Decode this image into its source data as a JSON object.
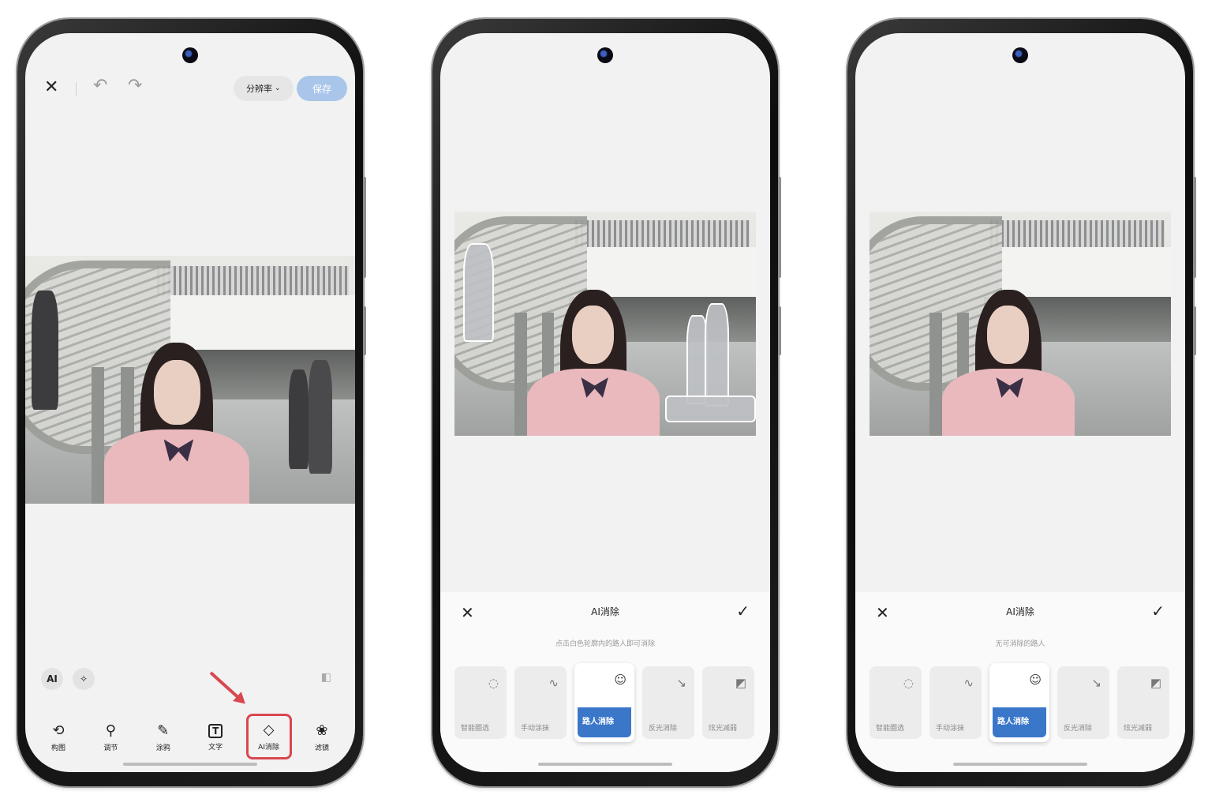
{
  "phone1": {
    "resolution_label": "分辨率",
    "save_label": "保存",
    "chips": [
      "AI"
    ],
    "tools": [
      {
        "label": "构图",
        "icon": "crop-rotate-icon"
      },
      {
        "label": "调节",
        "icon": "sliders-icon"
      },
      {
        "label": "涂鸦",
        "icon": "pen-icon"
      },
      {
        "label": "文字",
        "icon": "text-box-icon"
      },
      {
        "label": "AI消除",
        "icon": "eraser-icon"
      },
      {
        "label": "滤镜",
        "icon": "filter-circles-icon"
      }
    ]
  },
  "phone2": {
    "panel_title": "AI消除",
    "hint": "点击白色轮廓内的路人即可消除",
    "modes": [
      {
        "label": "智能圈选",
        "icon": "ai-lasso-icon"
      },
      {
        "label": "手动涂抹",
        "icon": "brush-stroke-icon"
      },
      {
        "label": "路人消除",
        "icon": "passerby-icon"
      },
      {
        "label": "反光消除",
        "icon": "reflection-icon"
      },
      {
        "label": "炫光减弱",
        "icon": "glare-icon"
      }
    ],
    "active_mode": "路人消除"
  },
  "phone3": {
    "panel_title": "AI消除",
    "hint": "无可消除的路人",
    "modes": [
      {
        "label": "智能圈选",
        "icon": "ai-lasso-icon"
      },
      {
        "label": "手动涂抹",
        "icon": "brush-stroke-icon"
      },
      {
        "label": "路人消除",
        "icon": "passerby-icon"
      },
      {
        "label": "反光消除",
        "icon": "reflection-icon"
      },
      {
        "label": "炫光减弱",
        "icon": "glare-icon"
      }
    ],
    "active_mode": "路人消除"
  },
  "colors": {
    "accent": "#3a77c9",
    "highlight": "#d9474f",
    "save_disabled": "#a9c6ea"
  }
}
